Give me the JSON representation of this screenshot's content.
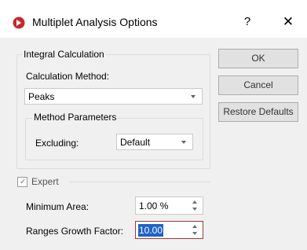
{
  "window": {
    "title": "Multiplet Analysis Options",
    "help_label": "?",
    "close_label": "✕",
    "icon": "app-logo-icon",
    "accent_color": "#c8282d"
  },
  "integral_calculation": {
    "group_label": "Integral Calculation",
    "calculation_method_label": "Calculation Method:",
    "calculation_method_value": "Peaks",
    "method_parameters": {
      "group_label": "Method Parameters",
      "excluding_label": "Excluding:",
      "excluding_value": "Default"
    }
  },
  "buttons": {
    "ok": "OK",
    "cancel": "Cancel",
    "restore_defaults": "Restore Defaults"
  },
  "expert": {
    "label": "Expert",
    "checked": true,
    "minimum_area_label": "Minimum Area:",
    "minimum_area_value": "1.00 %",
    "ranges_growth_factor_label": "Ranges Growth Factor:",
    "ranges_growth_factor_value": "10.00"
  }
}
